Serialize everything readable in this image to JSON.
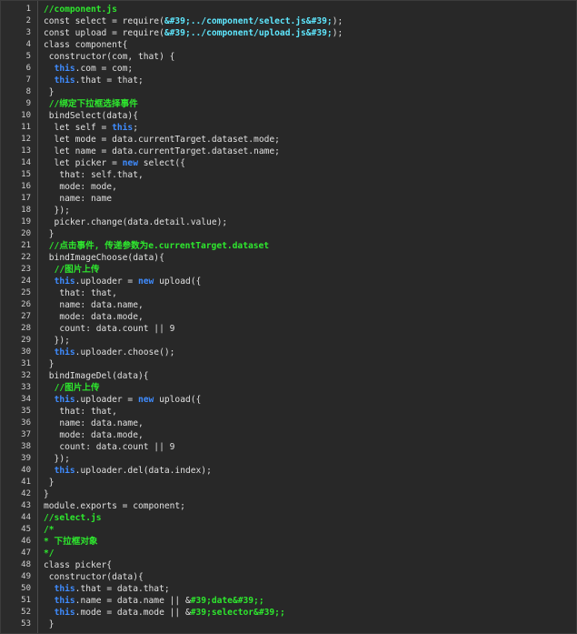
{
  "editor": {
    "lines": [
      [
        [
          "c",
          "//component.js"
        ]
      ],
      [
        [
          "p",
          "const select = require("
        ],
        [
          "s",
          "&#39;../component/select.js&#39;"
        ],
        [
          "p",
          ");"
        ]
      ],
      [
        [
          "p",
          "const upload = require("
        ],
        [
          "s",
          "&#39;../component/upload.js&#39;"
        ],
        [
          "p",
          ");"
        ]
      ],
      [
        [
          "p",
          "class component{"
        ]
      ],
      [
        [
          "p",
          " constructor(com, that) {"
        ]
      ],
      [
        [
          "p",
          "  "
        ],
        [
          "k",
          "this"
        ],
        [
          "p",
          ".com = com;"
        ]
      ],
      [
        [
          "p",
          "  "
        ],
        [
          "k",
          "this"
        ],
        [
          "p",
          ".that = that;"
        ]
      ],
      [
        [
          "p",
          " }"
        ]
      ],
      [
        [
          "p",
          " "
        ],
        [
          "c",
          "//绑定下拉框选择事件"
        ]
      ],
      [
        [
          "p",
          " bindSelect(data){"
        ]
      ],
      [
        [
          "p",
          "  let self = "
        ],
        [
          "k",
          "this"
        ],
        [
          "p",
          ";"
        ]
      ],
      [
        [
          "p",
          "  let mode = data.currentTarget.dataset.mode;"
        ]
      ],
      [
        [
          "p",
          "  let name = data.currentTarget.dataset.name;"
        ]
      ],
      [
        [
          "p",
          "  let picker = "
        ],
        [
          "k",
          "new"
        ],
        [
          "p",
          " select({"
        ]
      ],
      [
        [
          "p",
          "   that: self.that,"
        ]
      ],
      [
        [
          "p",
          "   mode: mode,"
        ]
      ],
      [
        [
          "p",
          "   name: name"
        ]
      ],
      [
        [
          "p",
          "  });"
        ]
      ],
      [
        [
          "p",
          "  picker.change(data.detail.value);"
        ]
      ],
      [
        [
          "p",
          " }"
        ]
      ],
      [
        [
          "p",
          " "
        ],
        [
          "c",
          "//点击事件, 传递参数为e.currentTarget.dataset"
        ]
      ],
      [
        [
          "p",
          " bindImageChoose(data){"
        ]
      ],
      [
        [
          "p",
          "  "
        ],
        [
          "c",
          "//图片上传"
        ]
      ],
      [
        [
          "p",
          "  "
        ],
        [
          "k",
          "this"
        ],
        [
          "p",
          ".uploader = "
        ],
        [
          "k",
          "new"
        ],
        [
          "p",
          " upload({"
        ]
      ],
      [
        [
          "p",
          "   that: that,"
        ]
      ],
      [
        [
          "p",
          "   name: data.name,"
        ]
      ],
      [
        [
          "p",
          "   mode: data.mode,"
        ]
      ],
      [
        [
          "p",
          "   count: data.count || 9"
        ]
      ],
      [
        [
          "p",
          "  });"
        ]
      ],
      [
        [
          "p",
          "  "
        ],
        [
          "k",
          "this"
        ],
        [
          "p",
          ".uploader.choose();"
        ]
      ],
      [
        [
          "p",
          " }"
        ]
      ],
      [
        [
          "p",
          " bindImageDel(data){"
        ]
      ],
      [
        [
          "p",
          "  "
        ],
        [
          "c",
          "//图片上传"
        ]
      ],
      [
        [
          "p",
          "  "
        ],
        [
          "k",
          "this"
        ],
        [
          "p",
          ".uploader = "
        ],
        [
          "k",
          "new"
        ],
        [
          "p",
          " upload({"
        ]
      ],
      [
        [
          "p",
          "   that: that,"
        ]
      ],
      [
        [
          "p",
          "   name: data.name,"
        ]
      ],
      [
        [
          "p",
          "   mode: data.mode,"
        ]
      ],
      [
        [
          "p",
          "   count: data.count || 9"
        ]
      ],
      [
        [
          "p",
          "  });"
        ]
      ],
      [
        [
          "p",
          "  "
        ],
        [
          "k",
          "this"
        ],
        [
          "p",
          ".uploader.del(data.index);"
        ]
      ],
      [
        [
          "p",
          " }"
        ]
      ],
      [
        [
          "p",
          "}"
        ]
      ],
      [
        [
          "p",
          "module.exports = component;"
        ]
      ],
      [
        [
          "c",
          "//select.js"
        ]
      ],
      [
        [
          "c",
          "/*"
        ]
      ],
      [
        [
          "c",
          "* 下拉框对象"
        ]
      ],
      [
        [
          "c",
          "*/"
        ]
      ],
      [
        [
          "p",
          "class picker{"
        ]
      ],
      [
        [
          "p",
          " constructor(data){"
        ]
      ],
      [
        [
          "p",
          "  "
        ],
        [
          "k",
          "this"
        ],
        [
          "p",
          ".that = data.that;"
        ]
      ],
      [
        [
          "p",
          "  "
        ],
        [
          "k",
          "this"
        ],
        [
          "p",
          ".name = data.name || &"
        ],
        [
          "c",
          "#39;date&#39;;"
        ]
      ],
      [
        [
          "p",
          "  "
        ],
        [
          "k",
          "this"
        ],
        [
          "p",
          ".mode = data.mode || &"
        ],
        [
          "c",
          "#39;selector&#39;;"
        ]
      ],
      [
        [
          "p",
          " }"
        ]
      ]
    ]
  }
}
